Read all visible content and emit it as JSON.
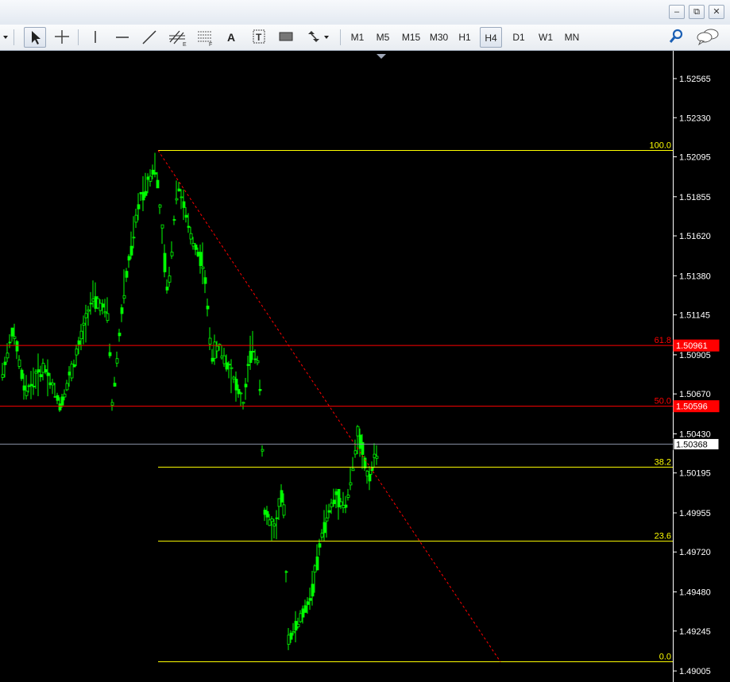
{
  "window": {
    "minimize_icon": "minimize-icon",
    "restore_icon": "restore-icon",
    "close_icon": "close-icon"
  },
  "toolbar": {
    "tools": [
      "cursor",
      "crosshair",
      "vertical-line",
      "horizontal-line",
      "trend-line",
      "equidistant-channel",
      "fibonacci-retracement",
      "text",
      "text-label",
      "rectangle",
      "arrows"
    ],
    "text_tool_label": "A",
    "timeframes": [
      "M1",
      "M5",
      "M15",
      "M30",
      "H1",
      "H4",
      "D1",
      "W1",
      "MN"
    ],
    "active_timeframe": "H4",
    "search_icon": "search-icon",
    "chat_icon": "chat-icon"
  },
  "chart": {
    "background": "#000000",
    "candle_color": "#00ff00",
    "fib_color": "#ffff00",
    "price_axis": {
      "ticks": [
        "1.52565",
        "1.52330",
        "1.52095",
        "1.51855",
        "1.51620",
        "1.51380",
        "1.51145",
        "1.50905",
        "1.50670",
        "1.50430",
        "1.50195",
        "1.49955",
        "1.49720",
        "1.49480",
        "1.49245",
        "1.49005"
      ]
    },
    "fib_levels": [
      {
        "label": "100.0",
        "price": 1.52133,
        "color": "#ffff00"
      },
      {
        "label": "61.8",
        "price": 1.50961,
        "color": "#ff0000"
      },
      {
        "label": "50.0",
        "price": 1.50596,
        "color": "#ff0000"
      },
      {
        "label": "38.2",
        "price": 1.5023,
        "color": "#ffff00"
      },
      {
        "label": "23.6",
        "price": 1.49785,
        "color": "#ffff00"
      },
      {
        "label": "0.0",
        "price": 1.4906,
        "color": "#ffff00"
      }
    ],
    "price_tags": [
      {
        "text": "1.50961",
        "bg": "#ff0000",
        "fg": "#ffffff"
      },
      {
        "text": "1.50596",
        "bg": "#ff0000",
        "fg": "#ffffff"
      },
      {
        "text": "1.50368",
        "bg": "#ffffff",
        "fg": "#000000"
      }
    ],
    "current_price": 1.50368,
    "trendline_color": "#ff0000"
  }
}
